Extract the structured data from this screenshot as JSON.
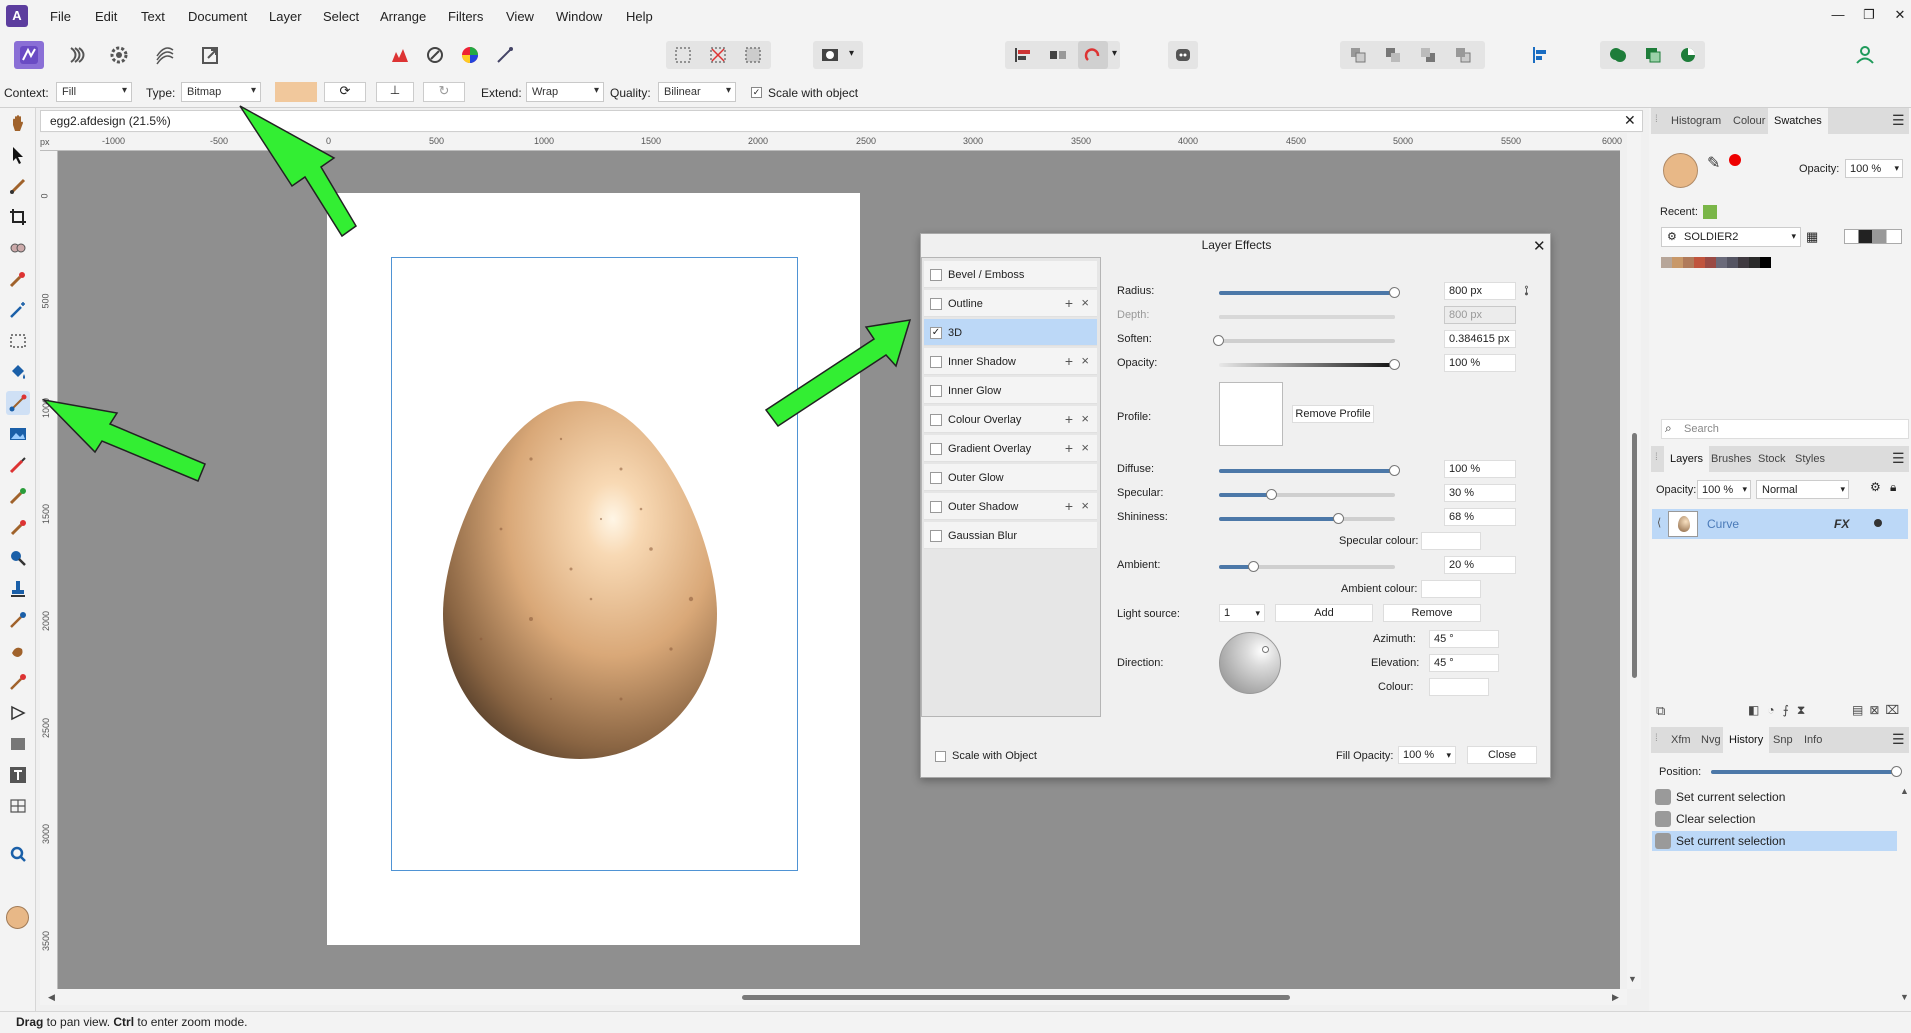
{
  "app": {
    "logo_glyph": "A"
  },
  "menu": {
    "items": [
      "File",
      "Edit",
      "Text",
      "Document",
      "Layer",
      "Select",
      "Arrange",
      "Filters",
      "View",
      "Window",
      "Help"
    ]
  },
  "window_controls": {
    "minimize": "—",
    "restore": "❐",
    "close": "✕"
  },
  "context_bar": {
    "context_label": "Context:",
    "context_value": "Fill",
    "type_label": "Type:",
    "type_value": "Bitmap",
    "extend_label": "Extend:",
    "extend_value": "Wrap",
    "quality_label": "Quality:",
    "quality_value": "Bilinear",
    "scale_label": "Scale with object",
    "fill_color": "#f1c89c"
  },
  "document": {
    "tab_title": "egg2.afdesign (21.5%)",
    "close": "✕"
  },
  "ruler": {
    "h_ticks": [
      "-1000",
      "-500",
      "0",
      "500",
      "1000",
      "1500",
      "2000",
      "2500",
      "3000",
      "3500",
      "4000",
      "4500",
      "5000",
      "5500",
      "6000"
    ],
    "v_ticks": [
      "0",
      "500",
      "1000",
      "1500",
      "2000",
      "2500",
      "3000",
      "3500"
    ],
    "unit": "px"
  },
  "status": {
    "bold1": "Drag",
    "text1": " to pan view. ",
    "bold2": "Ctrl",
    "text2": " to enter zoom mode."
  },
  "dialog": {
    "title": "Layer Effects",
    "close": "✕",
    "effects": [
      {
        "label": "Bevel / Emboss",
        "checked": false,
        "addable": false
      },
      {
        "label": "Outline",
        "checked": false,
        "addable": true
      },
      {
        "label": "3D",
        "checked": true,
        "addable": false
      },
      {
        "label": "Inner Shadow",
        "checked": false,
        "addable": true
      },
      {
        "label": "Inner Glow",
        "checked": false,
        "addable": false
      },
      {
        "label": "Colour Overlay",
        "checked": false,
        "addable": true
      },
      {
        "label": "Gradient Overlay",
        "checked": false,
        "addable": true
      },
      {
        "label": "Outer Glow",
        "checked": false,
        "addable": false
      },
      {
        "label": "Outer Shadow",
        "checked": false,
        "addable": true
      },
      {
        "label": "Gaussian Blur",
        "checked": false,
        "addable": false
      }
    ],
    "params": {
      "radius": {
        "label": "Radius:",
        "value": "800 px",
        "level": 1.0
      },
      "depth": {
        "label": "Depth:",
        "value": "800 px",
        "level": 1.0
      },
      "soften": {
        "label": "Soften:",
        "value": "0.384615 px",
        "level": 0.0
      },
      "opacity": {
        "label": "Opacity:",
        "value": "100 %",
        "level": 1.0
      },
      "profile_label": "Profile:",
      "remove_profile": "Remove Profile",
      "diffuse": {
        "label": "Diffuse:",
        "value": "100 %",
        "level": 1.0
      },
      "specular": {
        "label": "Specular:",
        "value": "30 %",
        "level": 0.3
      },
      "shininess": {
        "label": "Shininess:",
        "value": "68 %",
        "level": 0.68
      },
      "specular_colour": "Specular colour:",
      "ambient": {
        "label": "Ambient:",
        "value": "20 %",
        "level": 0.2
      },
      "ambient_colour": "Ambient colour:",
      "light_source_label": "Light source:",
      "light_source_value": "1",
      "add": "Add",
      "remove": "Remove",
      "direction_label": "Direction:",
      "azimuth_label": "Azimuth:",
      "azimuth_value": "45 °",
      "elevation_label": "Elevation:",
      "elevation_value": "45 °",
      "colour_label": "Colour:"
    },
    "scale_with_object": "Scale with Object",
    "fill_opacity_label": "Fill Opacity:",
    "fill_opacity_value": "100 %",
    "close_button": "Close"
  },
  "swatches_panel": {
    "tabs": [
      "Histogram",
      "Colour",
      "Swatches"
    ],
    "opacity_label": "Opacity:",
    "opacity_value": "100 %",
    "recent_label": "Recent:",
    "palette_name": "SOLDIER2",
    "primary_color": "#e8b887",
    "recent_color": "#7ab648",
    "palette_colors": [
      "#b7a699",
      "#c89869",
      "#b07a5a",
      "#c0543d",
      "#9a4a44",
      "#6a6a7a",
      "#545462",
      "#3f3a40",
      "#2a2a2a",
      "#000000"
    ],
    "search_placeholder": "Search"
  },
  "layers_panel": {
    "tabs": [
      "Layers",
      "Brushes",
      "Stock",
      "Styles"
    ],
    "opacity_label": "Opacity:",
    "opacity_value": "100 %",
    "blend_value": "Normal",
    "layer_name": "Curve",
    "fx_badge": "FX"
  },
  "history_panel": {
    "tabs": [
      "Xfm",
      "Nvg",
      "History",
      "Snp",
      "Info"
    ],
    "position_label": "Position:",
    "position_level": 1.0,
    "entries": [
      {
        "label": "Set current selection",
        "selected": false
      },
      {
        "label": "Clear selection",
        "selected": false
      },
      {
        "label": "Set current selection",
        "selected": true
      }
    ]
  }
}
